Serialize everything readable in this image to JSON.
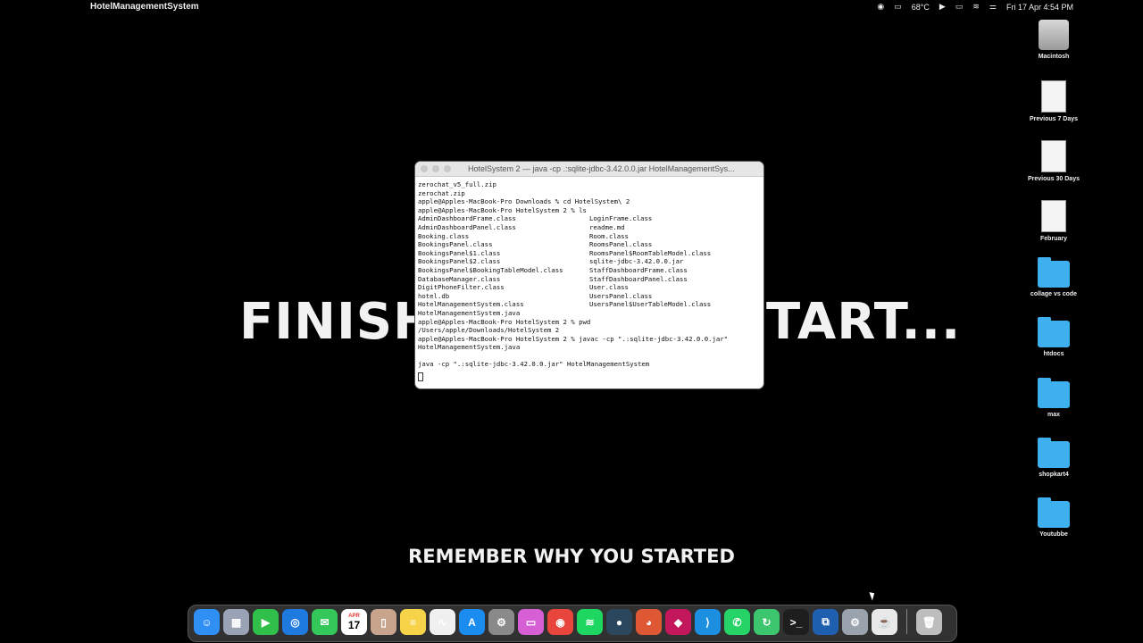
{
  "menubar": {
    "app_name": "HotelManagementSystem",
    "temperature": "68°C",
    "datetime": "Fri 17 Apr  4:54 PM"
  },
  "wallpaper": {
    "big_left": "FINISH",
    "big_right": "TART...",
    "tagline": "REMEMBER WHY YOU STARTED"
  },
  "desktop_icons": [
    {
      "label": "Macintosh",
      "type": "disk"
    },
    {
      "label": "Previous 7 Days",
      "type": "doc"
    },
    {
      "label": "Previous 30 Days",
      "type": "doc"
    },
    {
      "label": "February",
      "type": "doc"
    },
    {
      "label": "collage vs code",
      "type": "folder"
    },
    {
      "label": "htdocs",
      "type": "folder"
    },
    {
      "label": "max",
      "type": "folder"
    },
    {
      "label": "shopkart4",
      "type": "folder"
    },
    {
      "label": "Youtubbe",
      "type": "folder"
    }
  ],
  "terminal": {
    "title": "HotelSystem 2 — java -cp .:sqlite-jdbc-3.42.0.0.jar HotelManagementSys...",
    "lines_before": [
      "zerochat_v5_full.zip",
      "zerochat.zip",
      "apple@Apples-MacBook-Pro Downloads % cd HotelSystem\\ 2",
      "apple@Apples-MacBook-Pro HotelSystem 2 % ls"
    ],
    "ls_rows": [
      [
        "AdminDashboardFrame.class",
        "LoginFrame.class"
      ],
      [
        "AdminDashboardPanel.class",
        "readme.md"
      ],
      [
        "Booking.class",
        "Room.class"
      ],
      [
        "BookingsPanel.class",
        "RoomsPanel.class"
      ],
      [
        "BookingsPanel$1.class",
        "RoomsPanel$RoomTableModel.class"
      ],
      [
        "BookingsPanel$2.class",
        "sqlite-jdbc-3.42.0.0.jar"
      ],
      [
        "BookingsPanel$BookingTableModel.class",
        "StaffDashboardFrame.class"
      ],
      [
        "DatabaseManager.class",
        "StaffDashboardPanel.class"
      ],
      [
        "DigitPhoneFilter.class",
        "User.class"
      ],
      [
        "hotel.db",
        "UsersPanel.class"
      ],
      [
        "HotelManagementSystem.class",
        "UsersPanel$UserTableModel.class"
      ]
    ],
    "lines_after": [
      "HotelManagementSystem.java",
      "apple@Apples-MacBook-Pro HotelSystem 2 % pwd",
      "/Users/apple/Downloads/HotelSystem 2",
      "apple@Apples-MacBook-Pro HotelSystem 2 % javac -cp \".:sqlite-jdbc-3.42.0.0.jar\"",
      "HotelManagementSystem.java",
      "",
      "java -cp \".:sqlite-jdbc-3.42.0.0.jar\" HotelManagementSystem"
    ]
  },
  "dock": {
    "calendar_month": "APR",
    "calendar_day": "17",
    "apps": [
      {
        "name": "finder-icon",
        "color": "#2f8ff5",
        "glyph": "☺"
      },
      {
        "name": "launchpad-icon",
        "color": "#9aa3b5",
        "glyph": "▦"
      },
      {
        "name": "facetime-icon",
        "color": "#2fbf4a",
        "glyph": "▶"
      },
      {
        "name": "safari-icon",
        "color": "#1f7ae0",
        "glyph": "◎"
      },
      {
        "name": "messages-icon",
        "color": "#34c759",
        "glyph": "✉"
      },
      {
        "name": "calendar-icon",
        "color": "#ffffff",
        "glyph": ""
      },
      {
        "name": "iphone-mirroring-icon",
        "color": "#c9a48c",
        "glyph": "▯"
      },
      {
        "name": "notes-icon",
        "color": "#f7d34a",
        "glyph": "≡"
      },
      {
        "name": "freeform-icon",
        "color": "#f0f0f0",
        "glyph": "∿"
      },
      {
        "name": "app-store-icon",
        "color": "#1a8cf0",
        "glyph": "A"
      },
      {
        "name": "system-settings-icon",
        "color": "#8a8a8a",
        "glyph": "⚙"
      },
      {
        "name": "screens-icon",
        "color": "#d65fd6",
        "glyph": "▭"
      },
      {
        "name": "chrome-icon",
        "color": "#e8453c",
        "glyph": "◉"
      },
      {
        "name": "spotify-icon",
        "color": "#1ed760",
        "glyph": "≋"
      },
      {
        "name": "steam-icon",
        "color": "#2a475e",
        "glyph": "●"
      },
      {
        "name": "duckduckgo-icon",
        "color": "#de5833",
        "glyph": "◕"
      },
      {
        "name": "fig-icon",
        "color": "#c2185b",
        "glyph": "◆"
      },
      {
        "name": "vscode-icon",
        "color": "#1d8fe1",
        "glyph": "⟩"
      },
      {
        "name": "whatsapp-icon",
        "color": "#25d366",
        "glyph": "✆"
      },
      {
        "name": "utility-icon",
        "color": "#3cc66e",
        "glyph": "↻"
      },
      {
        "name": "terminal-icon",
        "color": "#1e1e1e",
        "glyph": ">_"
      },
      {
        "name": "network-icon",
        "color": "#1f5fb0",
        "glyph": "⧉"
      },
      {
        "name": "settings-utility-icon",
        "color": "#9aa2ad",
        "glyph": "⚙"
      },
      {
        "name": "java-app-icon",
        "color": "#e9e9e9",
        "glyph": "☕"
      }
    ],
    "trash": {
      "name": "trash-icon",
      "color": "#bdbdbd",
      "glyph": "🗑"
    }
  }
}
